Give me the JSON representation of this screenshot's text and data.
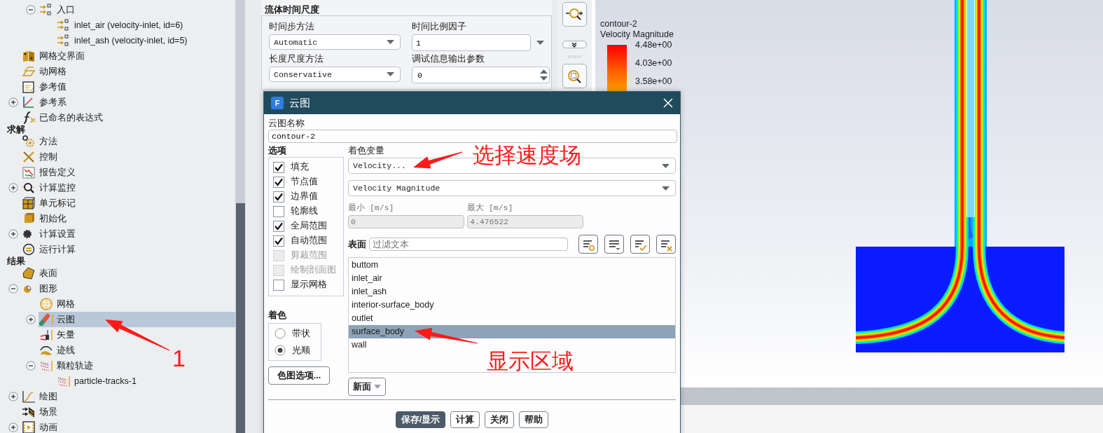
{
  "tree": [
    {
      "children": [
        {
          "children": [
            {
              "label": "入口",
              "kind": "inlet",
              "expanded": true,
              "selected": false,
              "children": [
                {
                  "label": "inlet_air (velocity-inlet, id=6)",
                  "kind": "inlet",
                  "selected": false
                },
                {
                  "label": "inlet_ash (velocity-inlet, id=5)",
                  "kind": "inlet",
                  "selected": false
                }
              ]
            }
          ]
        },
        {
          "label": "网格交界面",
          "kind": "mesh-interface",
          "selected": false
        },
        {
          "label": "动网格",
          "kind": "dynamic-mesh",
          "selected": false
        },
        {
          "label": "参考值",
          "kind": "reference-values",
          "selected": false
        },
        {
          "label": "参考系",
          "kind": "reference-frame",
          "expanded": false,
          "selected": false
        },
        {
          "label": "已命名的表达式",
          "kind": "expression",
          "selected": false
        }
      ]
    },
    {
      "label": "求解",
      "kind": "header",
      "selected": false,
      "children": [
        {
          "label": "方法",
          "kind": "methods",
          "selected": false
        },
        {
          "label": "控制",
          "kind": "controls",
          "selected": false
        },
        {
          "label": "报告定义",
          "kind": "report",
          "selected": false
        },
        {
          "label": "计算监控",
          "kind": "monitor",
          "expanded": false,
          "selected": false
        },
        {
          "label": "单元标记",
          "kind": "cell-register",
          "selected": false
        },
        {
          "label": "初始化",
          "kind": "init",
          "selected": false
        },
        {
          "label": "计算设置",
          "kind": "calc-settings",
          "expanded": false,
          "selected": false
        },
        {
          "label": "运行计算",
          "kind": "run",
          "selected": false
        }
      ]
    },
    {
      "label": "结果",
      "kind": "header",
      "selected": false,
      "children": [
        {
          "label": "表面",
          "kind": "surface",
          "selected": false
        },
        {
          "label": "图形",
          "kind": "graphics",
          "expanded": true,
          "selected": false,
          "children": [
            {
              "label": "网格",
              "kind": "mesh",
              "selected": false
            },
            {
              "label": "云图",
              "kind": "contour",
              "expanded": false,
              "selected": true
            },
            {
              "label": "矢量",
              "kind": "vector",
              "selected": false
            },
            {
              "label": "迹线",
              "kind": "pathline",
              "selected": false
            },
            {
              "label": "颗粒轨迹",
              "kind": "particle",
              "expanded": true,
              "selected": false,
              "children": [
                {
                  "label": "particle-tracks-1",
                  "kind": "particle",
                  "selected": false
                }
              ]
            }
          ]
        },
        {
          "label": "绘图",
          "kind": "plot",
          "expanded": false,
          "selected": false
        },
        {
          "label": "场景",
          "kind": "scene",
          "selected": false
        },
        {
          "label": "动画",
          "kind": "animation",
          "expanded": false,
          "selected": false
        }
      ]
    }
  ],
  "time_scale_group": {
    "title": "流体时间尺度",
    "fields": [
      {
        "label": "时间步方法",
        "kind": "dropdown",
        "value": "Automatic"
      },
      {
        "label": "时间比例因子",
        "kind": "combo",
        "value": "1"
      },
      {
        "label": "长度尺度方法",
        "kind": "dropdown",
        "value": "Conservative"
      },
      {
        "label": "调试信息输出参数",
        "kind": "spinner",
        "value": "0"
      }
    ]
  },
  "legend": {
    "title": "contour-2",
    "subtitle": "Velocity Magnitude",
    "labels": [
      "4.48e+00",
      "4.03e+00",
      "3.58e+00"
    ]
  },
  "dialog": {
    "logo": "F",
    "title": "云图",
    "name_label": "云图名称",
    "name_value": "contour-2",
    "options_title": "选项",
    "options": [
      {
        "label": "填充",
        "checked": true,
        "disabled": false
      },
      {
        "label": "节点值",
        "checked": true,
        "disabled": false
      },
      {
        "label": "边界值",
        "checked": true,
        "disabled": false
      },
      {
        "label": "轮廓线",
        "checked": false,
        "disabled": false
      },
      {
        "label": "全局范围",
        "checked": true,
        "disabled": false
      },
      {
        "label": "自动范围",
        "checked": true,
        "disabled": false
      },
      {
        "label": "剪裁范围",
        "checked": false,
        "disabled": true
      },
      {
        "label": "绘制剖面图",
        "checked": false,
        "disabled": true
      },
      {
        "label": "显示网格",
        "checked": false,
        "disabled": false
      }
    ],
    "coloring_title": "着色",
    "coloring": [
      {
        "label": "带状",
        "selected": false
      },
      {
        "label": "光顺",
        "selected": true
      }
    ],
    "colormap_button": "色图选项...",
    "variable_label": "着色变量",
    "variable": "Velocity...",
    "variable_sub": "Velocity Magnitude",
    "min_label": "最小 [m/s]",
    "min_value": "0",
    "max_label": "最大 [m/s]",
    "max_value": "4.476522",
    "surfaces_label": "表面",
    "filter_placeholder": "过滤文本",
    "surfaces": [
      {
        "label": "buttom",
        "selected": false
      },
      {
        "label": "inlet_air",
        "selected": false
      },
      {
        "label": "inlet_ash",
        "selected": false
      },
      {
        "label": "interior-surface_body",
        "selected": false
      },
      {
        "label": "outlet",
        "selected": false
      },
      {
        "label": "surface_body",
        "selected": true
      },
      {
        "label": "wall",
        "selected": false
      }
    ],
    "new_surface_button": "新面",
    "buttons": [
      {
        "label": "保存/显示",
        "primary": true
      },
      {
        "label": "计算",
        "primary": false
      },
      {
        "label": "关闭",
        "primary": false
      },
      {
        "label": "帮助",
        "primary": false
      }
    ]
  },
  "annotations": [
    {
      "text": "选择速度场"
    },
    {
      "text": "显示区域"
    },
    {
      "text": "1"
    }
  ]
}
